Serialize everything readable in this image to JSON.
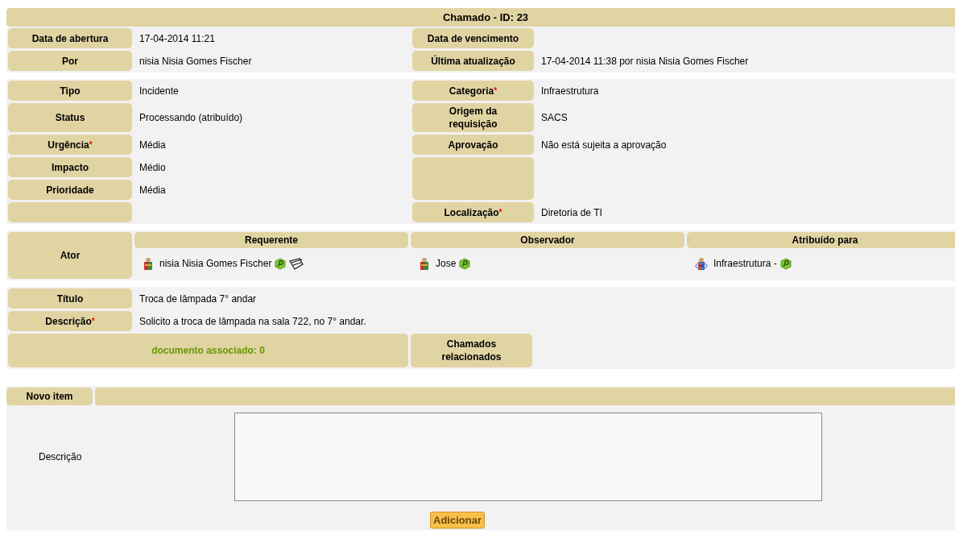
{
  "header": {
    "title": "Chamado - ID: 23"
  },
  "dates": [
    {
      "left": {
        "label": "Data de abertura",
        "value": "17-04-2014 11:21"
      },
      "right": {
        "label": "Data de vencimento"
      }
    },
    {
      "left": {
        "label": "Por",
        "value": "nisia Nisia Gomes Fischer"
      },
      "right": {
        "label": "Última atualização",
        "value": "17-04-2014 11:38 por nisia Nisia Gomes Fischer"
      }
    }
  ],
  "details": [
    {
      "left": {
        "label": "Tipo",
        "value": "Incidente"
      },
      "right": {
        "label": "Categoria",
        "mark": "*",
        "value": "Infraestrutura"
      }
    },
    {
      "left": {
        "label": "Status",
        "value": "Processando (atribuído)"
      },
      "right": {
        "label": "Origem da requisição",
        "value": "SACS"
      }
    },
    {
      "left": {
        "label": "Urgência",
        "mark": "*",
        "value": "Média"
      },
      "right": {
        "label": "Aprovação",
        "value": "Não está sujeita a aprovação"
      }
    },
    {
      "left": {
        "label": "Impacto",
        "value": "Médio"
      },
      "right": {
        "kind": "blank"
      }
    },
    {
      "left": {
        "label": "Prioridade",
        "value": "Média"
      }
    },
    {
      "left": {
        "kind": "blank"
      },
      "right": {
        "label": "Localização",
        "mark": "*",
        "value": "Diretoria de TI"
      }
    }
  ],
  "actors": {
    "label": "Ator",
    "columns": [
      {
        "heading": "Requerente",
        "name": "nisia Nisia Gomes Fischer",
        "kind": "user",
        "followup": true
      },
      {
        "heading": "Observador",
        "name": "Jose",
        "kind": "user",
        "followup": false
      },
      {
        "heading": "Atribuído para",
        "name": "Infraestrutura -",
        "kind": "group",
        "followup": false
      }
    ]
  },
  "description": {
    "rows": [
      {
        "label": "Título",
        "value": "Troca de lâmpada 7° andar"
      },
      {
        "label": "Descrição",
        "mark": "*",
        "value": "Solicito a troca de lâmpada na sala 722, no 7° andar."
      }
    ],
    "documents": "documento associado: 0",
    "related_label": "Chamados relacionados"
  },
  "new_item": {
    "tab": "Novo item",
    "field_label": "Descrição",
    "button": "Adicionar"
  }
}
